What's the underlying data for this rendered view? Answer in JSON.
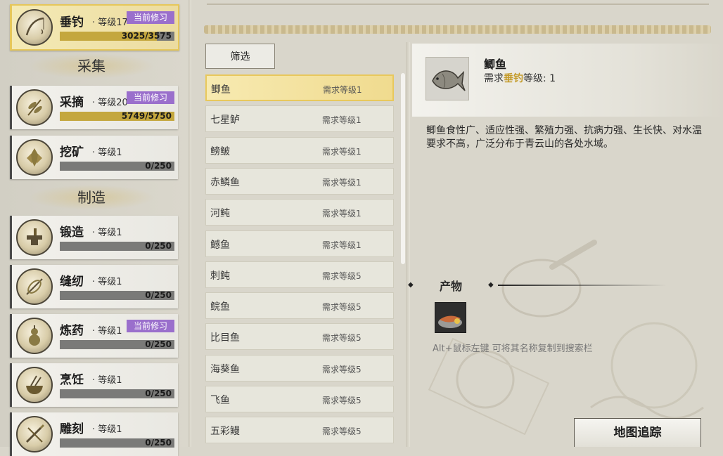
{
  "skills_gathering": [
    {
      "name": "垂钓",
      "level": "· 等级17",
      "badge": "当前修习",
      "progress": "3025/3575",
      "fill": 0.846,
      "icon": "fishing-icon",
      "active": true
    },
    {
      "name": "采摘",
      "level": "· 等级20",
      "badge": "当前修习",
      "progress": "5749/5750",
      "fill": 0.999,
      "icon": "herb-icon",
      "active": false
    },
    {
      "name": "挖矿",
      "level": "· 等级1",
      "badge": "",
      "progress": "0/250",
      "fill": 0,
      "icon": "mining-icon",
      "active": false
    }
  ],
  "skills_crafting": [
    {
      "name": "锻造",
      "level": "· 等级1",
      "badge": "",
      "progress": "0/250",
      "fill": 0,
      "icon": "anvil-icon"
    },
    {
      "name": "缝纫",
      "level": "· 等级1",
      "badge": "",
      "progress": "0/250",
      "fill": 0,
      "icon": "needle-icon"
    },
    {
      "name": "炼药",
      "level": "· 等级1",
      "badge": "当前修习",
      "progress": "0/250",
      "fill": 0,
      "icon": "gourd-icon"
    },
    {
      "name": "烹饪",
      "level": "· 等级1",
      "badge": "",
      "progress": "0/250",
      "fill": 0,
      "icon": "cooking-icon"
    },
    {
      "name": "雕刻",
      "level": "· 等级1",
      "badge": "",
      "progress": "0/250",
      "fill": 0,
      "icon": "carving-icon"
    }
  ],
  "sections": {
    "gather": "采集",
    "craft": "制造"
  },
  "filter_label": "筛选",
  "fish_list": [
    {
      "name": "鲫鱼",
      "req": "需求等级1"
    },
    {
      "name": "七星鲈",
      "req": "需求等级1"
    },
    {
      "name": "鳑鲏",
      "req": "需求等级1"
    },
    {
      "name": "赤鳞鱼",
      "req": "需求等级1"
    },
    {
      "name": "河鲀",
      "req": "需求等级1"
    },
    {
      "name": "鳡鱼",
      "req": "需求等级1"
    },
    {
      "name": "刺鲀",
      "req": "需求等级5"
    },
    {
      "name": "鲩鱼",
      "req": "需求等级5"
    },
    {
      "name": "比目鱼",
      "req": "需求等级5"
    },
    {
      "name": "海葵鱼",
      "req": "需求等级5"
    },
    {
      "name": "飞鱼",
      "req": "需求等级5"
    },
    {
      "name": "五彩鳗",
      "req": "需求等级5"
    }
  ],
  "selected_index": 0,
  "detail": {
    "name": "鲫鱼",
    "req_prefix": "需求",
    "req_skill": "垂钓",
    "req_suffix": "等级: 1",
    "description": "鲫鱼食性广、适应性强、繁殖力强、抗病力强、生长快、对水温要求不高，广泛分布于青云山的各处水域。",
    "product_title": "产物",
    "hint": "Alt+鼠标左键 可将其名称复制到搜索栏"
  },
  "map_button": "地图追踪",
  "colors": {
    "accent_gold": "#e8c85c",
    "badge_purple": "#9a6fcc",
    "bar_gray": "#7a7a78"
  }
}
